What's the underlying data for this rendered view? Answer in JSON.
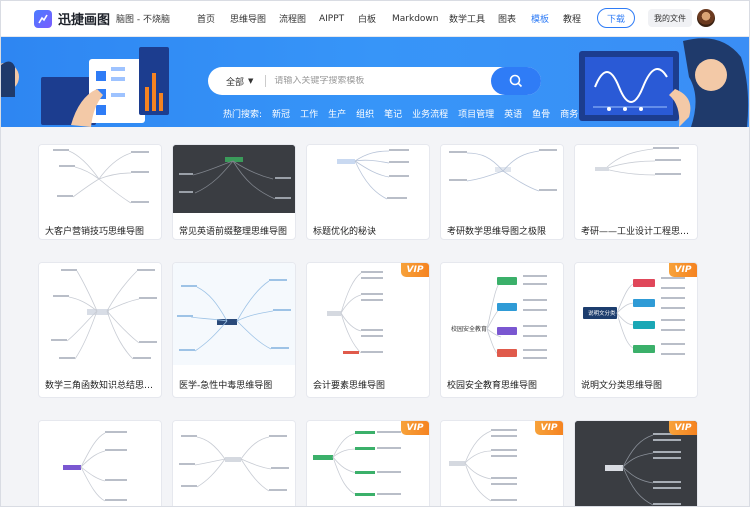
{
  "header": {
    "brand": "迅捷画图",
    "tagline": "脑图 - 不烧脑",
    "nav": [
      "首页",
      "思维导图",
      "流程图",
      "AIPPT",
      "白板",
      "Markdown",
      "数学工具",
      "图表",
      "模板",
      "教程"
    ],
    "active_nav": "模板",
    "download_label": "下载",
    "my_files_label": "我的文件"
  },
  "search": {
    "category": "全部",
    "placeholder": "请输入关键字搜索模板"
  },
  "hot_search": {
    "label": "热门搜索:",
    "tags": [
      "新冠",
      "工作",
      "生产",
      "组织",
      "笔记",
      "业务流程",
      "项目管理",
      "英语",
      "鱼骨",
      "商务"
    ]
  },
  "vip_badge": "VIP",
  "cards_row1": [
    "大客户营销技巧思维导图",
    "常见英语前缀整理思维导图",
    "标题优化的秘诀",
    "考研数学思维导图之极限",
    "考研——工业设计工程思维导..."
  ],
  "cards_row2": [
    "数学三角函数知识总结思维导图",
    "医学-急性中毒思维导图",
    "会计要素思维导图",
    "校园安全教育思维导图",
    "说明文分类思维导图"
  ],
  "thumb_text": {
    "campus_center": "校园安全教育",
    "expository_center": "说明文分类"
  },
  "colors": {
    "brand": "#2f7cf6",
    "hero": "#3795f8",
    "vip": "#f58321"
  }
}
